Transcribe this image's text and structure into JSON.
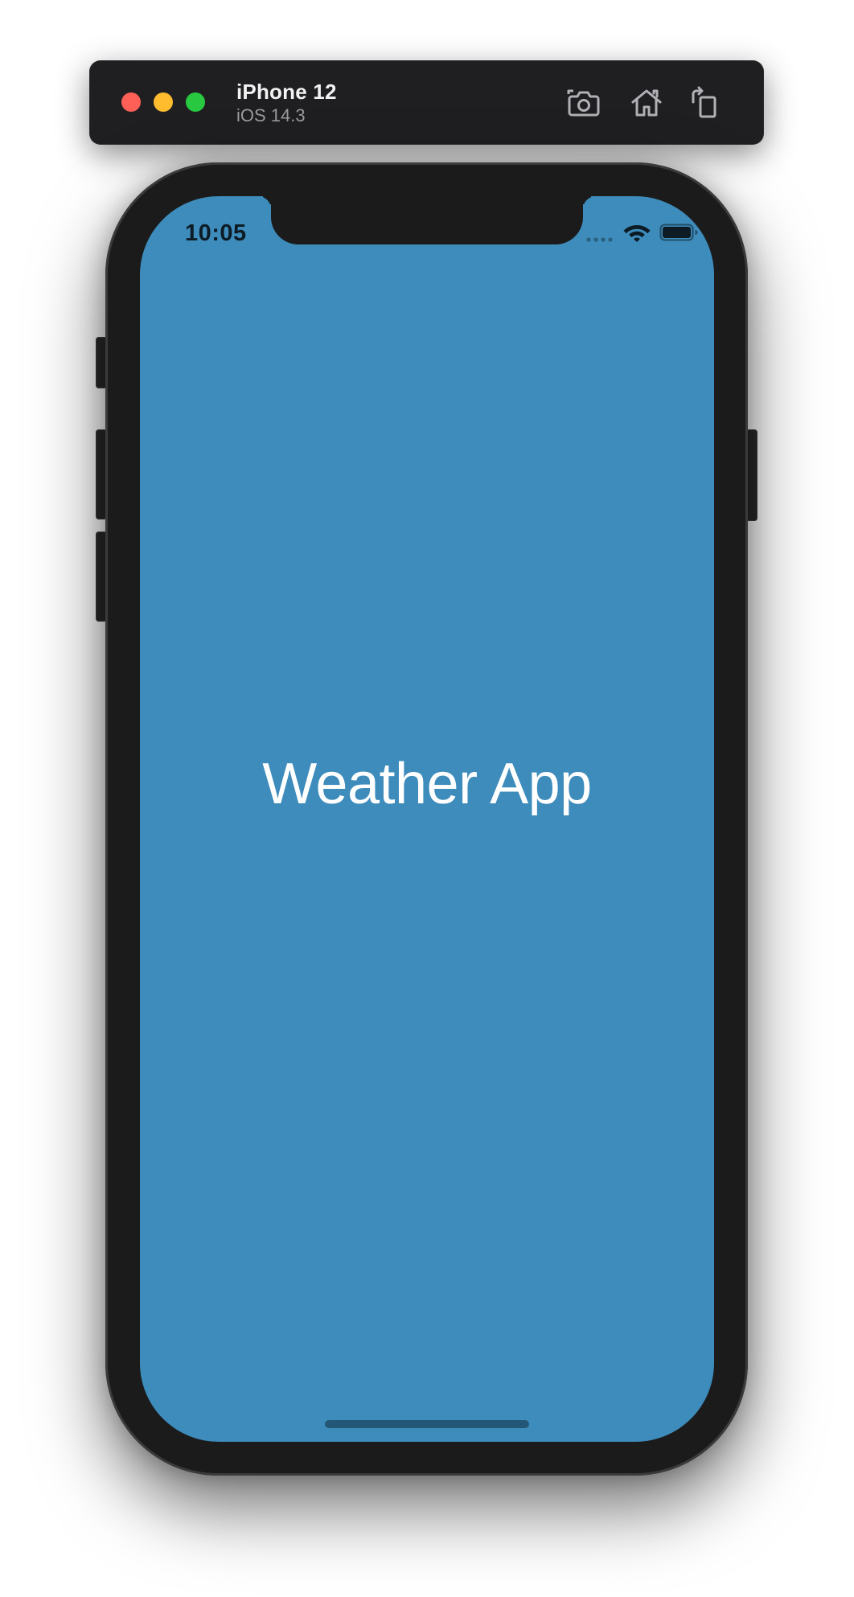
{
  "toolbar": {
    "device_name": "iPhone 12",
    "os_version": "iOS 14.3",
    "window_controls": {
      "close_color": "#fe5f57",
      "minimize_color": "#febc2e",
      "zoom_color": "#28c840"
    },
    "actions": [
      "camera-icon",
      "home-icon",
      "rotate-icon"
    ]
  },
  "status_bar": {
    "time": "10:05",
    "icons": [
      "cellular-signal-icon",
      "wifi-icon",
      "battery-icon"
    ]
  },
  "screen": {
    "background_color": "#3d8cbb",
    "title": "Weather App"
  }
}
